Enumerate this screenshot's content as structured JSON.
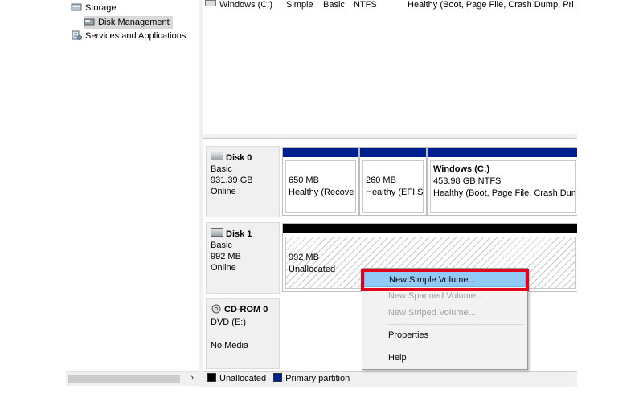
{
  "tree": {
    "items": [
      {
        "label": "Storage",
        "icon": "storage-icon"
      },
      {
        "label": "Disk Management",
        "icon": "disk-management-icon",
        "selected": true
      },
      {
        "label": "Services and Applications",
        "icon": "services-icon"
      }
    ],
    "scroll_arrow": "›"
  },
  "volume_list": {
    "row": {
      "volume": "Windows (C:)",
      "layout": "Simple",
      "type": "Basic",
      "file_system": "NTFS",
      "status": "Healthy (Boot, Page File, Crash Dump, Pri"
    }
  },
  "disks": [
    {
      "name": "Disk 0",
      "type": "Basic",
      "size": "931.39 GB",
      "status": "Online",
      "partitions": [
        {
          "title": "",
          "size": "650 MB",
          "status": "Healthy (Recove"
        },
        {
          "title": "",
          "size": "260 MB",
          "status": "Healthy (EFI S"
        },
        {
          "title": "Windows  (C:)",
          "size": "453.98 GB NTFS",
          "status": "Healthy (Boot, Page File, Crash Dum"
        }
      ]
    },
    {
      "name": "Disk 1",
      "type": "Basic",
      "size": "992 MB",
      "status": "Online",
      "partitions": [
        {
          "size": "992 MB",
          "status": "Unallocated"
        }
      ]
    },
    {
      "name": "CD-ROM 0",
      "type": "DVD (E:)",
      "status": "No Media"
    }
  ],
  "legend": {
    "unallocated": "Unallocated",
    "primary": "Primary partition",
    "unallocated_color": "#000000",
    "primary_color": "#001f8e"
  },
  "context_menu": {
    "items": [
      {
        "label": "New Simple Volume...",
        "enabled": true,
        "highlighted": true
      },
      {
        "label": "New Spanned Volume...",
        "enabled": false
      },
      {
        "label": "New Striped Volume...",
        "enabled": false
      },
      {
        "label": "Properties",
        "enabled": true
      },
      {
        "label": "Help",
        "enabled": true
      }
    ]
  },
  "colors": {
    "highlight": "#91c9f7",
    "callout_border": "#e2001a",
    "partition_header": "#001f8e"
  }
}
